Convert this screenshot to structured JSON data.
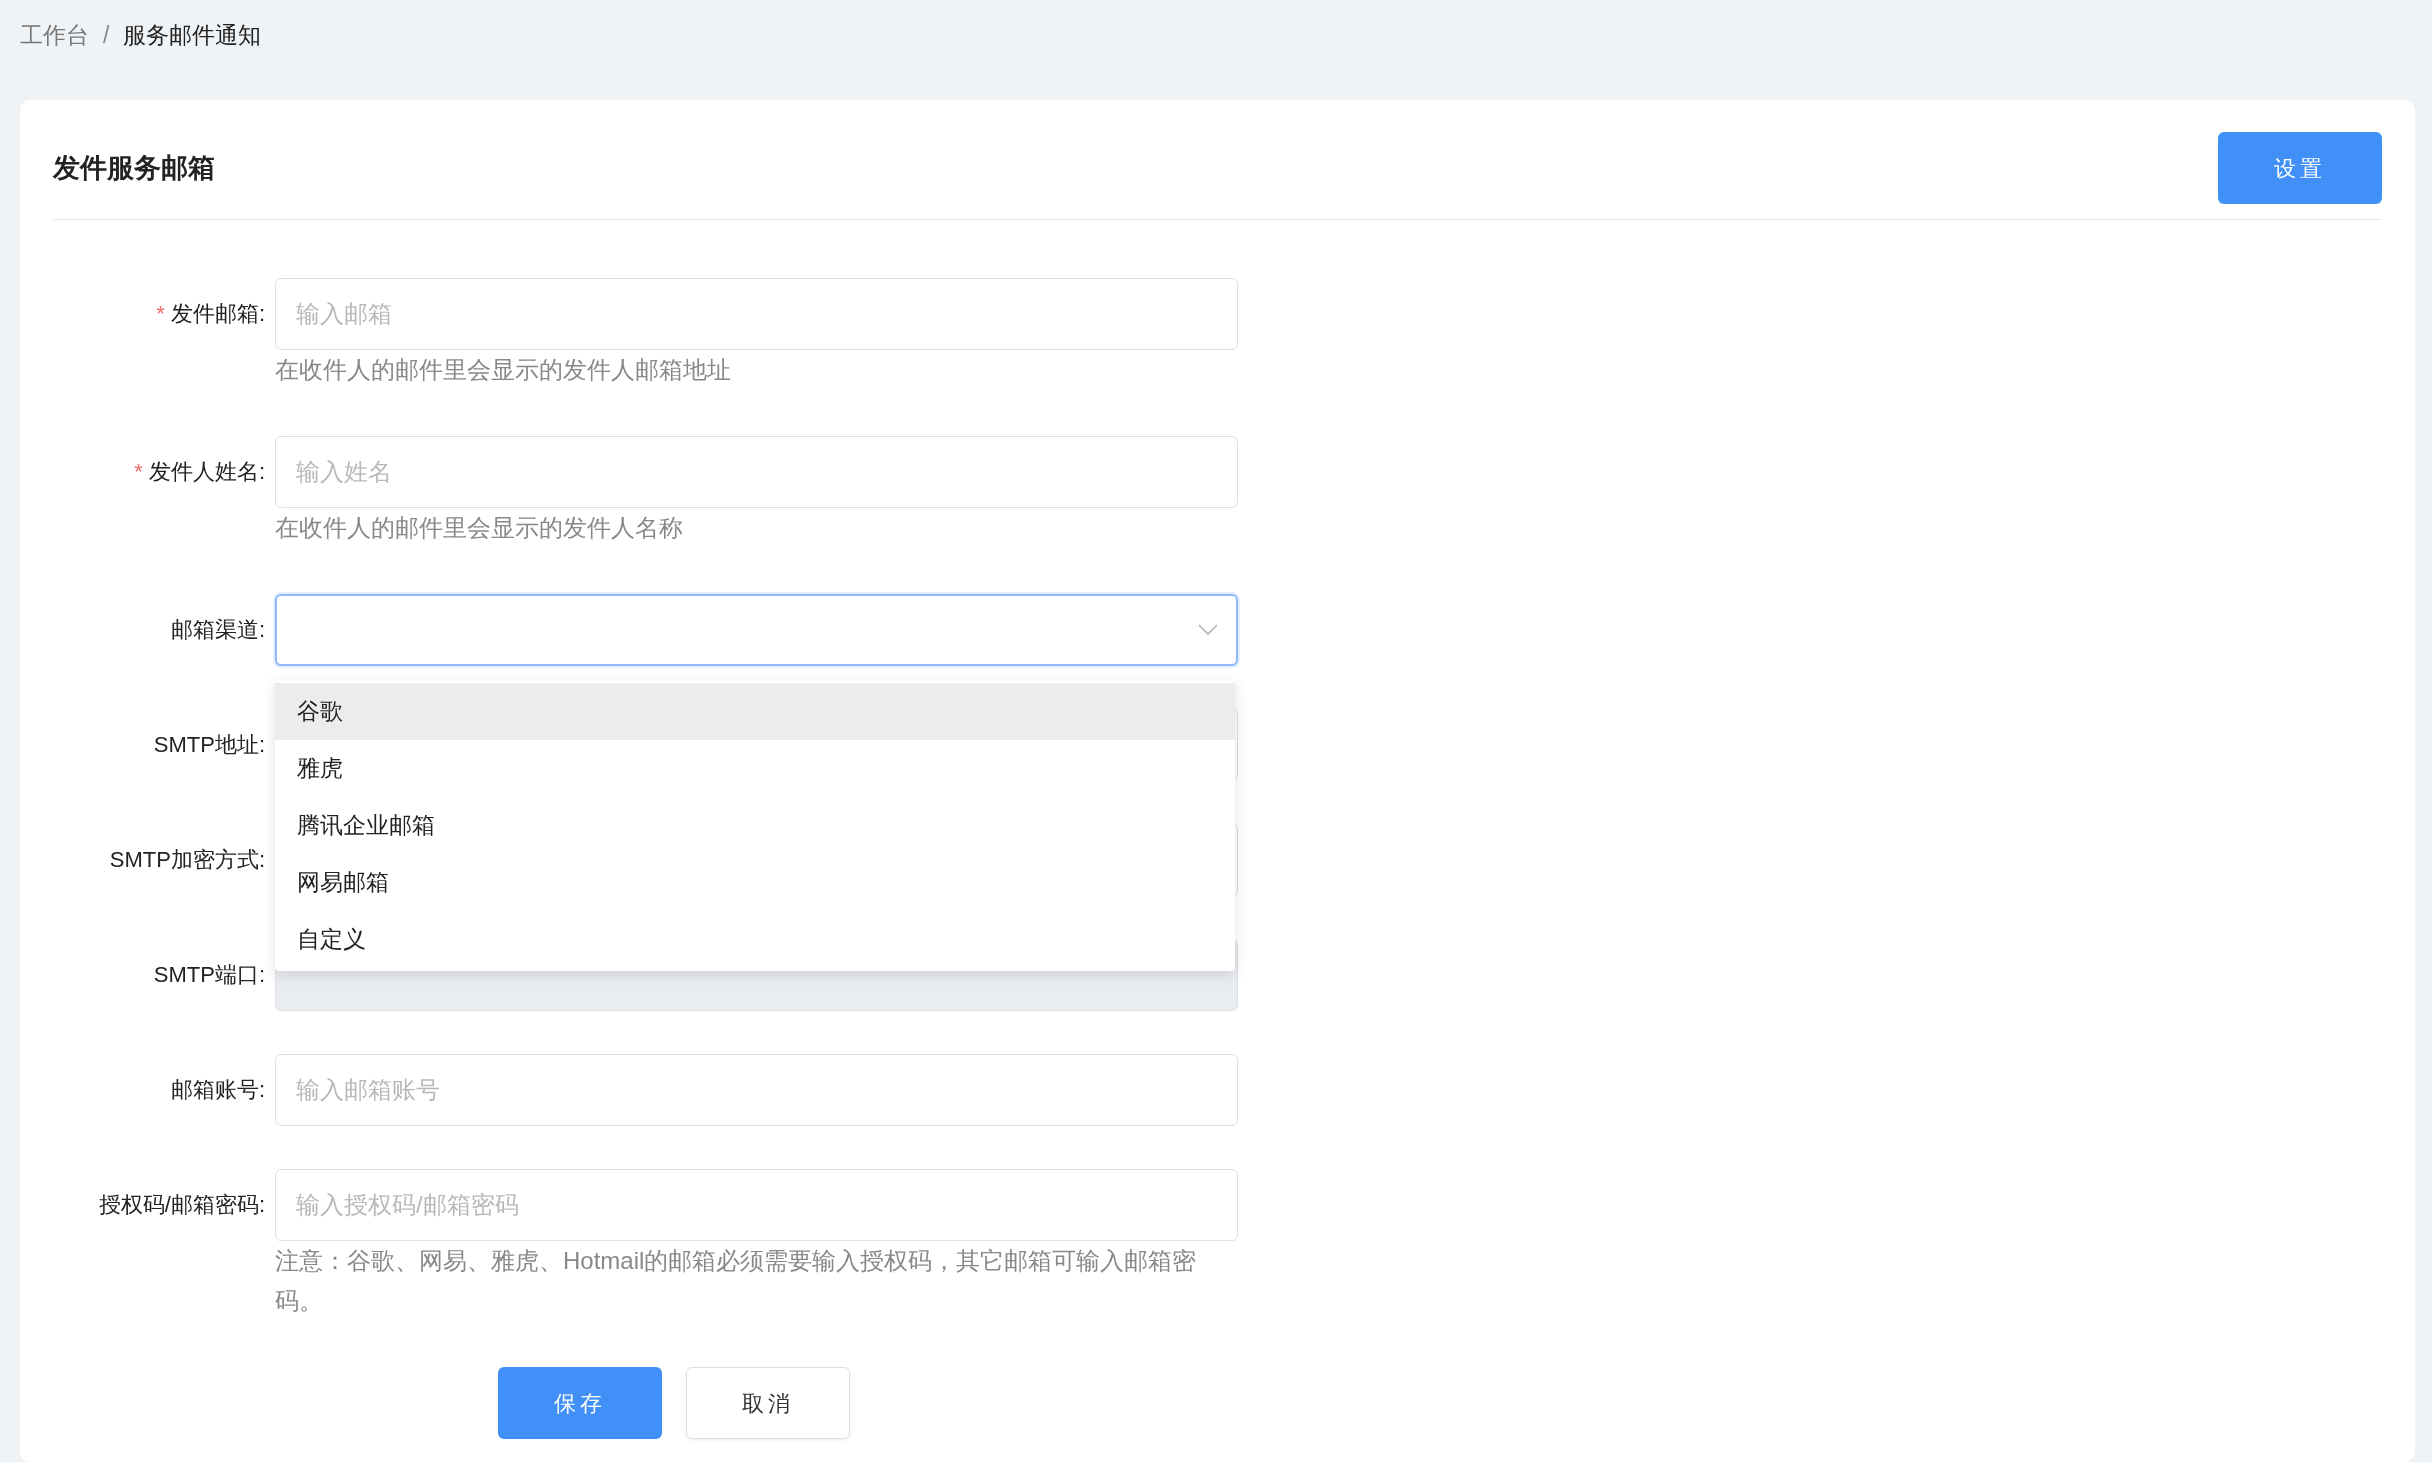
{
  "breadcrumb": {
    "separator": "/",
    "items": [
      {
        "label": "工作台",
        "current": false
      },
      {
        "label": "服务邮件通知",
        "current": true
      }
    ]
  },
  "card": {
    "title": "发件服务邮箱",
    "settings_button": "设置"
  },
  "form": {
    "required_mark": "*",
    "fields": [
      {
        "kind": "input",
        "label": "发件邮箱:",
        "required": true,
        "placeholder": "输入邮箱",
        "hint": "在收件人的邮件里会显示的发件人邮箱地址",
        "disabled": false
      },
      {
        "kind": "input",
        "label": "发件人姓名:",
        "required": true,
        "placeholder": "输入姓名",
        "hint": "在收件人的邮件里会显示的发件人名称",
        "disabled": false
      },
      {
        "kind": "select",
        "label": "邮箱渠道:",
        "required": false,
        "disabled": false,
        "expanded": true,
        "options": [
          {
            "label": "谷歌",
            "hovered": true
          },
          {
            "label": "雅虎",
            "hovered": false
          },
          {
            "label": "腾讯企业邮箱",
            "hovered": false
          },
          {
            "label": "网易邮箱",
            "hovered": false
          },
          {
            "label": "自定义",
            "hovered": false
          }
        ]
      },
      {
        "kind": "input",
        "label": "SMTP地址:",
        "required": false
      },
      {
        "kind": "input",
        "label": "SMTP加密方式:",
        "required": false
      },
      {
        "kind": "input",
        "label": "SMTP端口:",
        "required": false,
        "disabled": true
      },
      {
        "kind": "input",
        "label": "邮箱账号:",
        "required": false,
        "placeholder": "输入邮箱账号",
        "disabled": false
      },
      {
        "kind": "input",
        "label": "授权码/邮箱密码:",
        "required": false,
        "placeholder": "输入授权码/邮箱密码",
        "hint": "注意：谷歌、网易、雅虎、Hotmail的邮箱必须需要输入授权码，其它邮箱可输入邮箱密码。",
        "disabled": false
      }
    ]
  },
  "buttons": [
    {
      "label": "保存",
      "kind": "primary"
    },
    {
      "label": "取消",
      "kind": "default"
    }
  ]
}
